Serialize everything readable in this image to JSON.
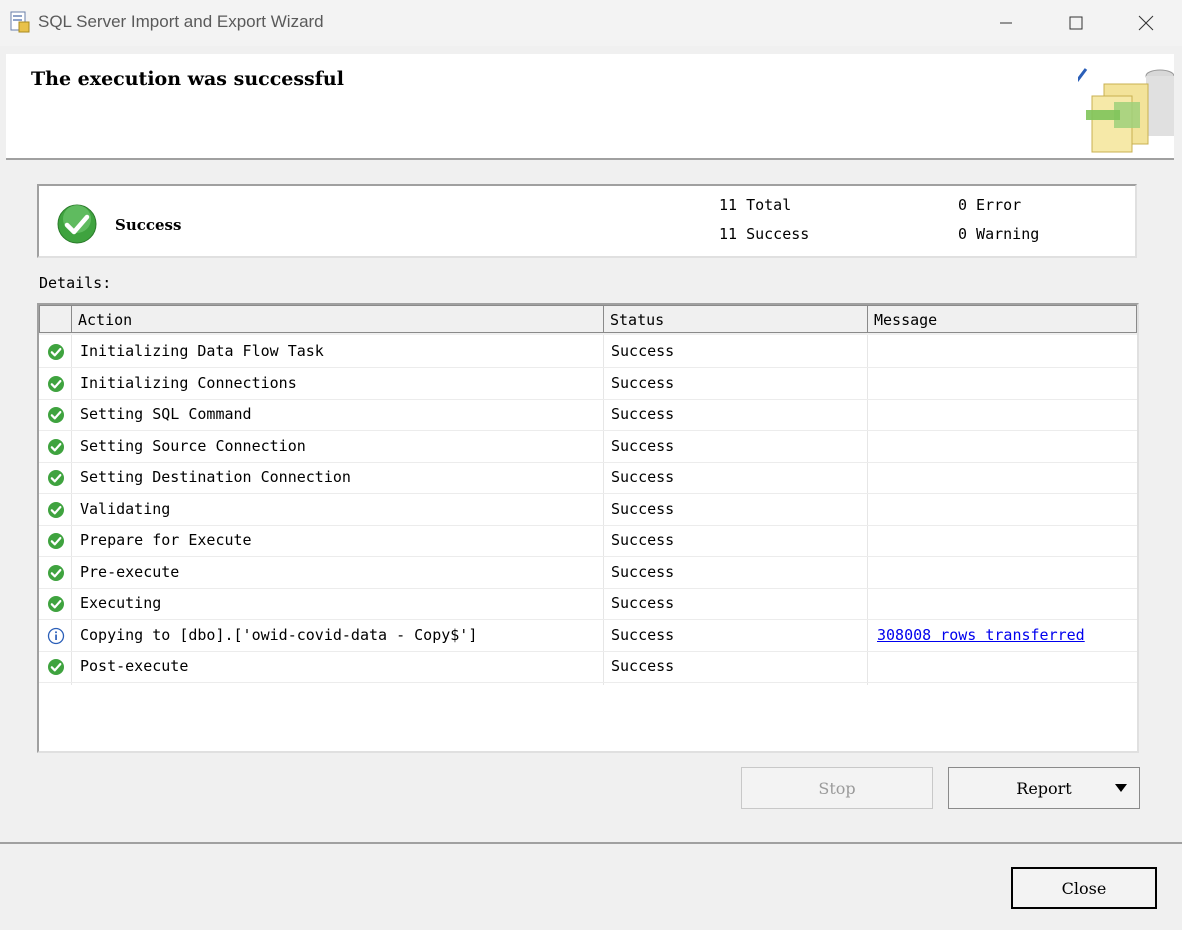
{
  "window": {
    "title": "SQL Server Import and Export Wizard"
  },
  "header": {
    "title": "The execution was successful"
  },
  "summary": {
    "status": "Success",
    "total": "11 Total",
    "success": "11 Success",
    "error": "0 Error",
    "warning": "0 Warning"
  },
  "details": {
    "label": "Details:",
    "columns": [
      "Action",
      "Status",
      "Message"
    ],
    "rows": [
      {
        "icon": "success-icon",
        "action": "Initializing Data Flow Task",
        "status": "Success",
        "message": ""
      },
      {
        "icon": "success-icon",
        "action": "Initializing Connections",
        "status": "Success",
        "message": ""
      },
      {
        "icon": "success-icon",
        "action": "Setting SQL Command",
        "status": "Success",
        "message": ""
      },
      {
        "icon": "success-icon",
        "action": "Setting Source Connection",
        "status": "Success",
        "message": ""
      },
      {
        "icon": "success-icon",
        "action": "Setting Destination Connection",
        "status": "Success",
        "message": ""
      },
      {
        "icon": "success-icon",
        "action": "Validating",
        "status": "Success",
        "message": ""
      },
      {
        "icon": "success-icon",
        "action": "Prepare for Execute",
        "status": "Success",
        "message": ""
      },
      {
        "icon": "success-icon",
        "action": "Pre-execute",
        "status": "Success",
        "message": ""
      },
      {
        "icon": "success-icon",
        "action": "Executing",
        "status": "Success",
        "message": ""
      },
      {
        "icon": "info-icon",
        "action": "Copying to [dbo].['owid-covid-data - Copy$']",
        "status": "Success",
        "message": "308008 rows transferred"
      },
      {
        "icon": "success-icon",
        "action": "Post-execute",
        "status": "Success",
        "message": ""
      }
    ]
  },
  "buttons": {
    "stop": "Stop",
    "report": "Report",
    "close": "Close"
  },
  "colors": {
    "success": "#3fa33f",
    "info": "#2b5fb8",
    "link": "#0000ee"
  }
}
